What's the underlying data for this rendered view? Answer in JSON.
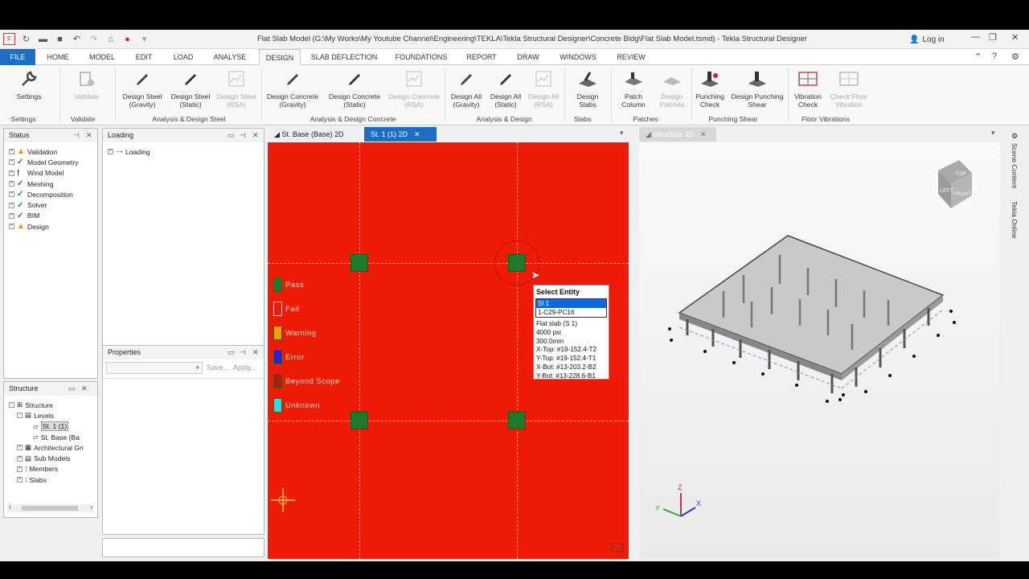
{
  "title": "Flat Slab Model (G:\\My Works\\My Youtube Channel\\Engineering\\TEKLA\\Tekla Structural Designer\\Concrete Bldg\\Flat Slab Model.tsmd) - Tekla Structural Designer",
  "login": "Log in",
  "menu": {
    "file": "FILE",
    "tabs": [
      "HOME",
      "MODEL",
      "EDIT",
      "LOAD",
      "ANALYSE",
      "DESIGN",
      "SLAB DEFLECTION",
      "FOUNDATIONS",
      "REPORT",
      "DRAW",
      "WINDOWS",
      "REVIEW"
    ]
  },
  "ribbon": {
    "buttons": [
      "Settings",
      "Validate",
      "Design Steel (Gravity)",
      "Design Steel (Static)",
      "Design Steel (RSA)",
      "Design Concrete (Gravity)",
      "Design Concrete (Static)",
      "Design Concrete (RSA)",
      "Design All (Gravity)",
      "Design All (Static)",
      "Design All (RSA)",
      "Design Slabs",
      "Patch Column",
      "Design Patches",
      "Punching Check",
      "Design Punching Shear",
      "Vibration Check",
      "Check Floor Vibration"
    ],
    "groups": [
      "Settings",
      "Validate",
      "Analysis & Design Steel",
      "Analysis & Design Concrete",
      "Analysis & Design",
      "Slabs",
      "Patches",
      "Punching Shear",
      "Floor Vibrations"
    ]
  },
  "status_panel": {
    "title": "Status",
    "items": [
      {
        "label": "Validation",
        "state": "warning"
      },
      {
        "label": "Model Geometry",
        "state": "ok"
      },
      {
        "label": "Wind Model",
        "state": "info"
      },
      {
        "label": "Meshing",
        "state": "ok"
      },
      {
        "label": "Decomposition",
        "state": "ok"
      },
      {
        "label": "Solver",
        "state": "ok"
      },
      {
        "label": "BIM",
        "state": "ok"
      },
      {
        "label": "Design",
        "state": "warning"
      }
    ]
  },
  "loading_panel": {
    "title": "Loading",
    "root": "Loading"
  },
  "properties_panel": {
    "title": "Properties",
    "save": "Save...",
    "apply": "Apply..."
  },
  "structure_panel": {
    "title": "Structure",
    "items": [
      "Structure",
      "Levels",
      "St. 1 (1)",
      "St. Base (Ba",
      "Architectural Gri",
      "Sub Models",
      "Members",
      "Slabs"
    ]
  },
  "doc_tabs": [
    "St. Base (Base) 2D",
    "St. 1 (1) 2D",
    "Structure 3D"
  ],
  "legend": [
    {
      "label": "Pass",
      "color": "#1d7a2a"
    },
    {
      "label": "Fail",
      "color": "#ee1c07"
    },
    {
      "label": "Warning",
      "color": "#ff9900"
    },
    {
      "label": "Error",
      "color": "#2222ee"
    },
    {
      "label": "Beyond Scope",
      "color": "#b01a10"
    },
    {
      "label": "Unknown",
      "color": "#22ddee"
    }
  ],
  "popup": {
    "title": "Select Entity",
    "options": [
      "Sl 1",
      "1-C29-PC16"
    ],
    "lines": [
      "Flat slab (S 1)",
      "4000 psi",
      "300.0mm",
      "X-Top: #19-152.4-T2",
      "Y-Top: #19-152.4-T1",
      "X-Bot: #13-203.2-B2",
      "Y-Bot: #13-228.6-B1"
    ]
  },
  "view2d_tag": "2D",
  "viewcube": {
    "top": "TOP",
    "left": "LEFT",
    "front": "FRONT"
  },
  "side_tabs": [
    "Scene Content",
    "Tekla Online"
  ]
}
